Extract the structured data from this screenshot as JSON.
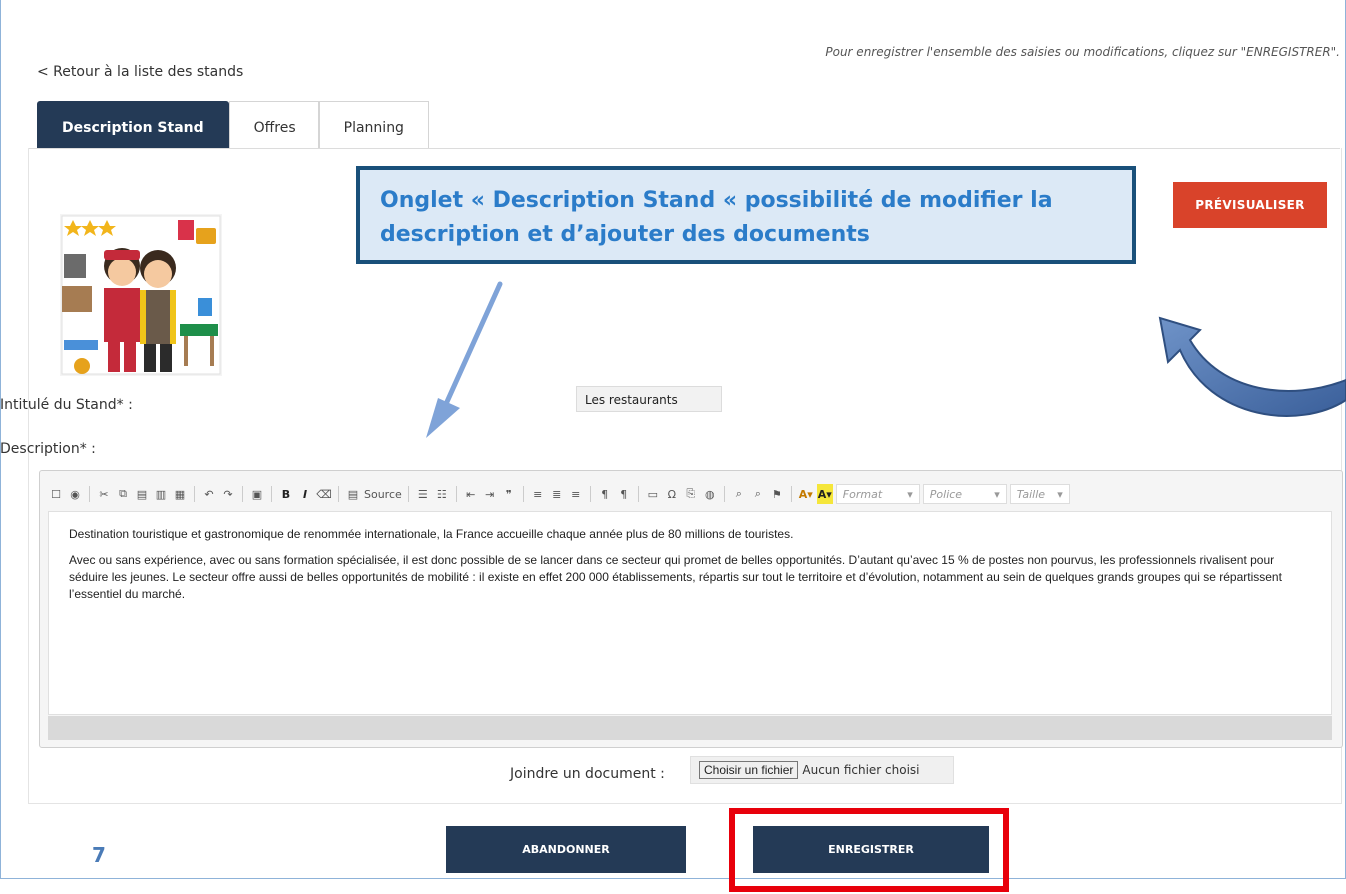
{
  "header": {
    "back_link": "< Retour à la liste des stands",
    "notice": "Pour enregistrer l'ensemble des saisies ou modifications, cliquez sur \"ENREGISTRER\"."
  },
  "tabs": [
    {
      "label": "Description Stand",
      "active": true
    },
    {
      "label": "Offres",
      "active": false
    },
    {
      "label": "Planning",
      "active": false
    }
  ],
  "callout": {
    "text": "Onglet « Description Stand «  possibilité de modifier la description et  d’ajouter des documents"
  },
  "preview_button": "PRÉVISUALISER",
  "form": {
    "stand_title_label": "Intitulé du Stand* :",
    "stand_title_value": "Les restaurants",
    "description_label": "Description* :"
  },
  "editor": {
    "toolbar": {
      "source_label": "Source",
      "bold_label": "B",
      "italic_label": "I",
      "format_label": "Format",
      "font_label": "Police",
      "size_label": "Taille"
    },
    "paragraphs": [
      "Destination touristique et gastronomique de renommée internationale, la France accueille chaque année plus de 80 millions de touristes.",
      "Avec ou sans expérience, avec ou sans formation spécialisée, il est donc possible de se lancer dans ce secteur qui promet de belles opportunités. D’autant qu’avec 15 % de postes non pourvus, les professionnels rivalisent pour séduire les jeunes. Le secteur offre aussi de belles opportunités de mobilité : il existe en effet 200 000 établissements, répartis sur tout le territoire et d’évolution, notamment au sein de quelques grands groupes qui se répartissent l’essentiel du marché."
    ]
  },
  "attachment": {
    "label": "Joindre un document :",
    "button": "Choisir un fichier",
    "status": "Aucun fichier choisi"
  },
  "actions": {
    "cancel": "ABANDONNER",
    "save": "ENREGISTRER"
  },
  "page_number": "7",
  "colors": {
    "navy": "#243a56",
    "preview_red": "#d9432a",
    "callout_border": "#19507a",
    "callout_text": "#2b7cc9",
    "highlight_red": "#e8000b"
  }
}
